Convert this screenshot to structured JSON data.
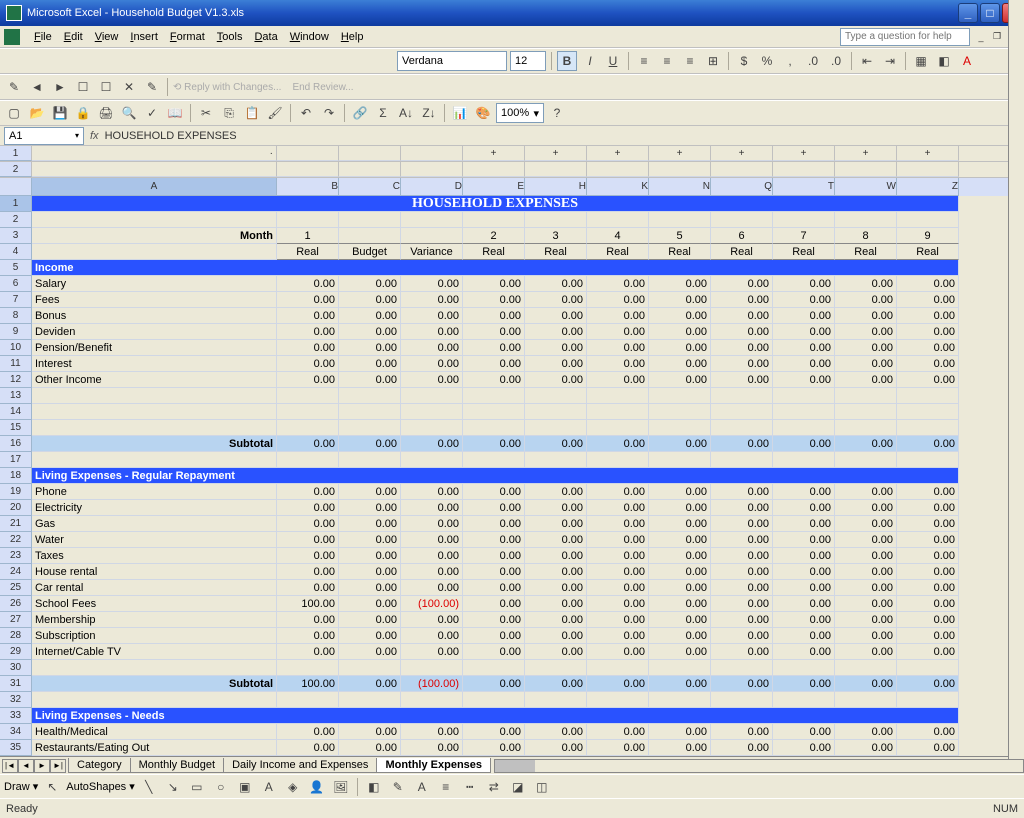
{
  "window": {
    "title": "Microsoft Excel - Household Budget V1.3.xls"
  },
  "menu": [
    "File",
    "Edit",
    "View",
    "Insert",
    "Format",
    "Tools",
    "Data",
    "Window",
    "Help"
  ],
  "helpPlaceholder": "Type a question for help",
  "font": {
    "name": "Verdana",
    "size": "12"
  },
  "zoom": "100%",
  "namebox": "A1",
  "formula": "HOUSEHOLD EXPENSES",
  "columns": [
    "A",
    "B",
    "C",
    "D",
    "E",
    "H",
    "K",
    "N",
    "Q",
    "T",
    "W",
    "Z"
  ],
  "titleText": "HOUSEHOLD EXPENSES",
  "monthLabel": "Month",
  "months": [
    "1",
    "",
    "",
    "2",
    "3",
    "4",
    "5",
    "6",
    "7",
    "8",
    "9"
  ],
  "headers": [
    "Real",
    "Budget",
    "Variance",
    "Real",
    "Real",
    "Real",
    "Real",
    "Real",
    "Real",
    "Real",
    "Real"
  ],
  "rows": [
    {
      "n": 5,
      "type": "section",
      "label": "Income"
    },
    {
      "n": 6,
      "type": "data",
      "label": "Salary",
      "vals": [
        "0.00",
        "0.00",
        "0.00",
        "0.00",
        "0.00",
        "0.00",
        "0.00",
        "0.00",
        "0.00",
        "0.00",
        "0.00"
      ]
    },
    {
      "n": 7,
      "type": "data",
      "label": "Fees",
      "vals": [
        "0.00",
        "0.00",
        "0.00",
        "0.00",
        "0.00",
        "0.00",
        "0.00",
        "0.00",
        "0.00",
        "0.00",
        "0.00"
      ]
    },
    {
      "n": 8,
      "type": "data",
      "label": "Bonus",
      "vals": [
        "0.00",
        "0.00",
        "0.00",
        "0.00",
        "0.00",
        "0.00",
        "0.00",
        "0.00",
        "0.00",
        "0.00",
        "0.00"
      ]
    },
    {
      "n": 9,
      "type": "data",
      "label": "Deviden",
      "vals": [
        "0.00",
        "0.00",
        "0.00",
        "0.00",
        "0.00",
        "0.00",
        "0.00",
        "0.00",
        "0.00",
        "0.00",
        "0.00"
      ]
    },
    {
      "n": 10,
      "type": "data",
      "label": "Pension/Benefit",
      "vals": [
        "0.00",
        "0.00",
        "0.00",
        "0.00",
        "0.00",
        "0.00",
        "0.00",
        "0.00",
        "0.00",
        "0.00",
        "0.00"
      ]
    },
    {
      "n": 11,
      "type": "data",
      "label": "Interest",
      "vals": [
        "0.00",
        "0.00",
        "0.00",
        "0.00",
        "0.00",
        "0.00",
        "0.00",
        "0.00",
        "0.00",
        "0.00",
        "0.00"
      ]
    },
    {
      "n": 12,
      "type": "data",
      "label": "Other Income",
      "vals": [
        "0.00",
        "0.00",
        "0.00",
        "0.00",
        "0.00",
        "0.00",
        "0.00",
        "0.00",
        "0.00",
        "0.00",
        "0.00"
      ]
    },
    {
      "n": 13,
      "type": "blank"
    },
    {
      "n": 14,
      "type": "blank"
    },
    {
      "n": 15,
      "type": "blank"
    },
    {
      "n": 16,
      "type": "subtotal",
      "label": "Subtotal",
      "vals": [
        "0.00",
        "0.00",
        "0.00",
        "0.00",
        "0.00",
        "0.00",
        "0.00",
        "0.00",
        "0.00",
        "0.00",
        "0.00"
      ]
    },
    {
      "n": 17,
      "type": "blank"
    },
    {
      "n": 18,
      "type": "section",
      "label": "Living Expenses - Regular Repayment"
    },
    {
      "n": 19,
      "type": "data",
      "label": "Phone",
      "vals": [
        "0.00",
        "0.00",
        "0.00",
        "0.00",
        "0.00",
        "0.00",
        "0.00",
        "0.00",
        "0.00",
        "0.00",
        "0.00"
      ]
    },
    {
      "n": 20,
      "type": "data",
      "label": "Electricity",
      "vals": [
        "0.00",
        "0.00",
        "0.00",
        "0.00",
        "0.00",
        "0.00",
        "0.00",
        "0.00",
        "0.00",
        "0.00",
        "0.00"
      ]
    },
    {
      "n": 21,
      "type": "data",
      "label": "Gas",
      "vals": [
        "0.00",
        "0.00",
        "0.00",
        "0.00",
        "0.00",
        "0.00",
        "0.00",
        "0.00",
        "0.00",
        "0.00",
        "0.00"
      ]
    },
    {
      "n": 22,
      "type": "data",
      "label": "Water",
      "vals": [
        "0.00",
        "0.00",
        "0.00",
        "0.00",
        "0.00",
        "0.00",
        "0.00",
        "0.00",
        "0.00",
        "0.00",
        "0.00"
      ]
    },
    {
      "n": 23,
      "type": "data",
      "label": "Taxes",
      "vals": [
        "0.00",
        "0.00",
        "0.00",
        "0.00",
        "0.00",
        "0.00",
        "0.00",
        "0.00",
        "0.00",
        "0.00",
        "0.00"
      ]
    },
    {
      "n": 24,
      "type": "data",
      "label": "House rental",
      "vals": [
        "0.00",
        "0.00",
        "0.00",
        "0.00",
        "0.00",
        "0.00",
        "0.00",
        "0.00",
        "0.00",
        "0.00",
        "0.00"
      ]
    },
    {
      "n": 25,
      "type": "data",
      "label": "Car rental",
      "vals": [
        "0.00",
        "0.00",
        "0.00",
        "0.00",
        "0.00",
        "0.00",
        "0.00",
        "0.00",
        "0.00",
        "0.00",
        "0.00"
      ]
    },
    {
      "n": 26,
      "type": "data",
      "label": "School Fees",
      "vals": [
        "100.00",
        "0.00",
        "(100.00)",
        "0.00",
        "0.00",
        "0.00",
        "0.00",
        "0.00",
        "0.00",
        "0.00",
        "0.00"
      ],
      "neg": [
        2
      ]
    },
    {
      "n": 27,
      "type": "data",
      "label": "Membership",
      "vals": [
        "0.00",
        "0.00",
        "0.00",
        "0.00",
        "0.00",
        "0.00",
        "0.00",
        "0.00",
        "0.00",
        "0.00",
        "0.00"
      ]
    },
    {
      "n": 28,
      "type": "data",
      "label": "Subscription",
      "vals": [
        "0.00",
        "0.00",
        "0.00",
        "0.00",
        "0.00",
        "0.00",
        "0.00",
        "0.00",
        "0.00",
        "0.00",
        "0.00"
      ]
    },
    {
      "n": 29,
      "type": "data",
      "label": "Internet/Cable TV",
      "vals": [
        "0.00",
        "0.00",
        "0.00",
        "0.00",
        "0.00",
        "0.00",
        "0.00",
        "0.00",
        "0.00",
        "0.00",
        "0.00"
      ]
    },
    {
      "n": 30,
      "type": "blank"
    },
    {
      "n": 31,
      "type": "subtotal",
      "label": "Subtotal",
      "vals": [
        "100.00",
        "0.00",
        "(100.00)",
        "0.00",
        "0.00",
        "0.00",
        "0.00",
        "0.00",
        "0.00",
        "0.00",
        "0.00"
      ],
      "neg": [
        2
      ]
    },
    {
      "n": 32,
      "type": "blank"
    },
    {
      "n": 33,
      "type": "section",
      "label": "Living Expenses - Needs"
    },
    {
      "n": 34,
      "type": "data",
      "label": "Health/Medical",
      "vals": [
        "0.00",
        "0.00",
        "0.00",
        "0.00",
        "0.00",
        "0.00",
        "0.00",
        "0.00",
        "0.00",
        "0.00",
        "0.00"
      ]
    },
    {
      "n": 35,
      "type": "data",
      "label": "Restaurants/Eating Out",
      "vals": [
        "0.00",
        "0.00",
        "0.00",
        "0.00",
        "0.00",
        "0.00",
        "0.00",
        "0.00",
        "0.00",
        "0.00",
        "0.00"
      ]
    }
  ],
  "sheetTabs": [
    "Category",
    "Monthly Budget",
    "Daily Income and Expenses",
    "Monthly Expenses"
  ],
  "activeTab": 3,
  "draw": {
    "label": "Draw ▾",
    "autoshapes": "AutoShapes ▾"
  },
  "status": {
    "ready": "Ready",
    "num": "NUM"
  }
}
